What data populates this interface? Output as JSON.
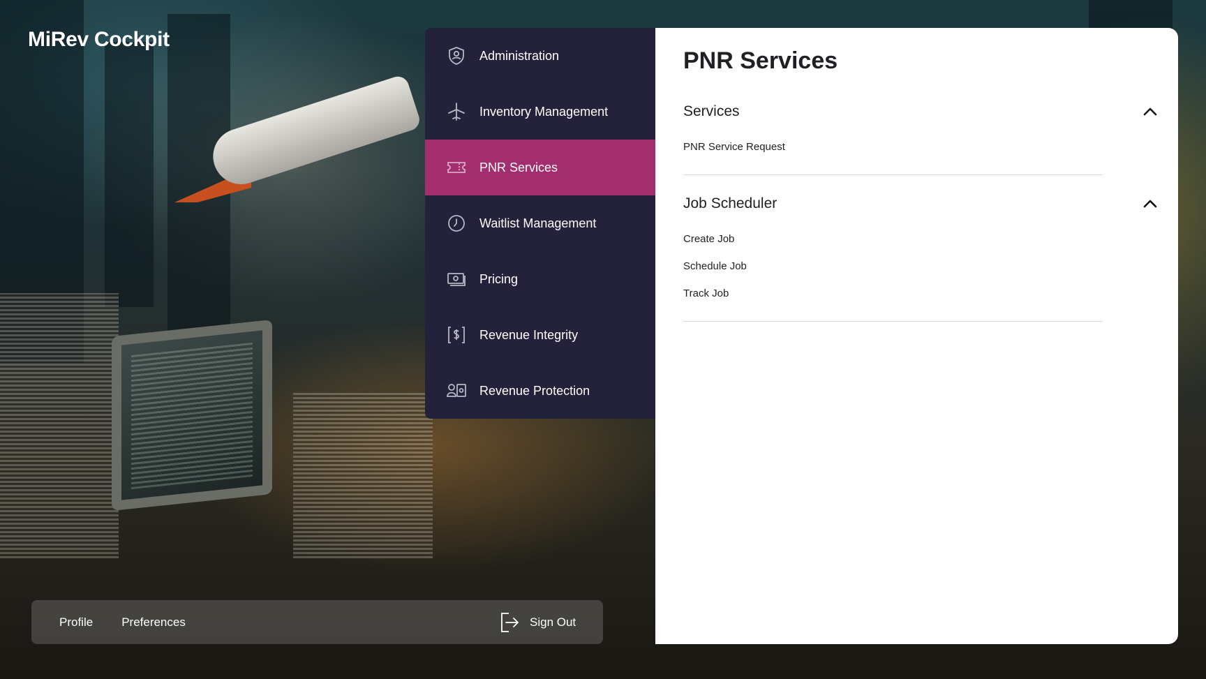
{
  "app": {
    "title": "MiRev Cockpit"
  },
  "menu": {
    "items": [
      {
        "label": "Administration",
        "icon": "shield-user-icon",
        "active": false
      },
      {
        "label": "Inventory Management",
        "icon": "airplane-icon",
        "active": false
      },
      {
        "label": "PNR Services",
        "icon": "ticket-icon",
        "active": true
      },
      {
        "label": "Waitlist Management",
        "icon": "clock-icon",
        "active": false
      },
      {
        "label": "Pricing",
        "icon": "cash-icon",
        "active": false
      },
      {
        "label": "Revenue Integrity",
        "icon": "dollar-bracket-icon",
        "active": false
      },
      {
        "label": "Revenue Protection",
        "icon": "user-safe-icon",
        "active": false
      }
    ]
  },
  "panel": {
    "title": "PNR Services",
    "sections": [
      {
        "title": "Services",
        "expanded": true,
        "links": [
          "PNR Service Request"
        ]
      },
      {
        "title": "Job Scheduler",
        "expanded": true,
        "links": [
          "Create Job",
          "Schedule Job",
          "Track Job"
        ]
      }
    ]
  },
  "footer": {
    "profile": "Profile",
    "preferences": "Preferences",
    "sign_out": "Sign Out"
  },
  "colors": {
    "menu_bg": "#23223a",
    "active_item": "#a22e6d",
    "panel_bg": "#ffffff"
  }
}
